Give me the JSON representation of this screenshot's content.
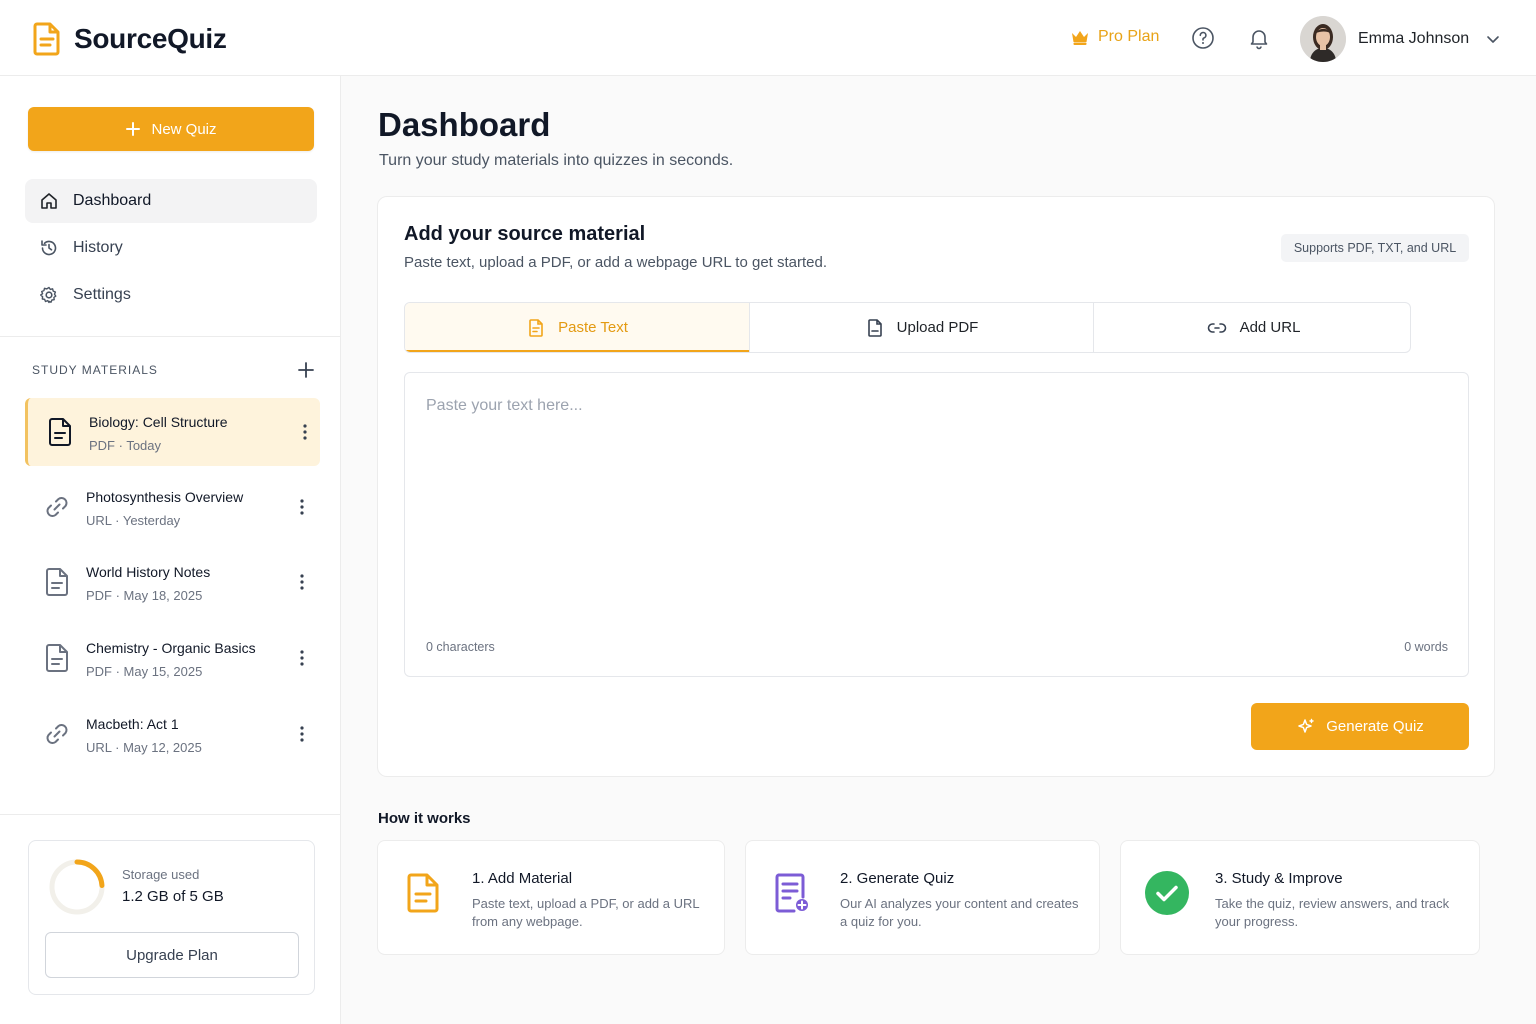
{
  "app": {
    "name": "SourceQuiz",
    "logo_icon": "document-icon"
  },
  "header": {
    "plan_label": "Pro Plan",
    "plan_icon": "crown-icon",
    "help_icon": "help-circle-icon",
    "notifications_icon": "bell-icon",
    "user_name": "Emma Johnson",
    "user_menu_icon": "chevron-down-icon"
  },
  "sidebar": {
    "new_quiz_label": "New Quiz",
    "nav": [
      {
        "label": "Dashboard",
        "icon": "home-icon",
        "active": true
      },
      {
        "label": "History",
        "icon": "history-icon",
        "active": false
      },
      {
        "label": "Settings",
        "icon": "gear-icon",
        "active": false
      }
    ],
    "materials_title": "STUDY MATERIALS",
    "materials": [
      {
        "title": "Biology: Cell Structure",
        "type": "PDF",
        "date": "Today",
        "sub": "PDF · Today",
        "icon": "pdf-file-icon",
        "active": true
      },
      {
        "title": "Photosynthesis Overview",
        "type": "URL",
        "date": "Yesterday",
        "sub": "URL · Yesterday",
        "icon": "link-icon",
        "active": false
      },
      {
        "title": "World History Notes",
        "type": "PDF",
        "date": "May 18, 2025",
        "sub": "PDF · May 18, 2025",
        "icon": "pdf-file-icon",
        "active": false
      },
      {
        "title": "Chemistry - Organic Basics",
        "type": "PDF",
        "date": "May 15, 2025",
        "sub": "PDF · May 15, 2025",
        "icon": "pdf-file-icon",
        "active": false
      },
      {
        "title": "Macbeth: Act 1",
        "type": "URL",
        "date": "May 12, 2025",
        "sub": "URL · May 12, 2025",
        "icon": "link-icon",
        "active": false
      }
    ],
    "storage": {
      "label": "Storage used",
      "value": "1.2 GB of 5 GB",
      "used_fraction": 0.24
    },
    "upgrade_label": "Upgrade Plan"
  },
  "main": {
    "title": "Dashboard",
    "subtitle": "Turn your study materials into quizzes in seconds.",
    "source_card": {
      "title": "Add your source material",
      "subtitle": "Paste text, upload a PDF, or add a webpage URL to get started.",
      "support_badge": "Supports PDF, TXT, and URL",
      "tabs": [
        {
          "label": "Paste Text",
          "icon": "text-file-icon",
          "active": true
        },
        {
          "label": "Upload PDF",
          "icon": "file-icon",
          "active": false
        },
        {
          "label": "Add URL",
          "icon": "link-icon",
          "active": false
        }
      ],
      "textarea_placeholder": "Paste your text here...",
      "char_count": "0 characters",
      "word_count": "0 words",
      "generate_label": "Generate Quiz",
      "generate_icon": "sparkle-icon"
    },
    "how_it_works": {
      "title": "How it works",
      "steps": [
        {
          "title": "1. Add Material",
          "desc": "Paste text, upload a PDF, or add a URL from any webpage.",
          "icon": "document-icon"
        },
        {
          "title": "2. Generate Quiz",
          "desc": "Our AI analyzes your content and creates a quiz for you.",
          "icon": "quiz-generate-icon"
        },
        {
          "title": "3. Study & Improve",
          "desc": "Take the quiz, review answers, and track your progress.",
          "icon": "check-circle-icon"
        }
      ]
    }
  },
  "colors": {
    "accent": "#f2a51a",
    "active_bg": "#fef3dc",
    "purple": "#7c5cd6",
    "success": "#34b660"
  }
}
